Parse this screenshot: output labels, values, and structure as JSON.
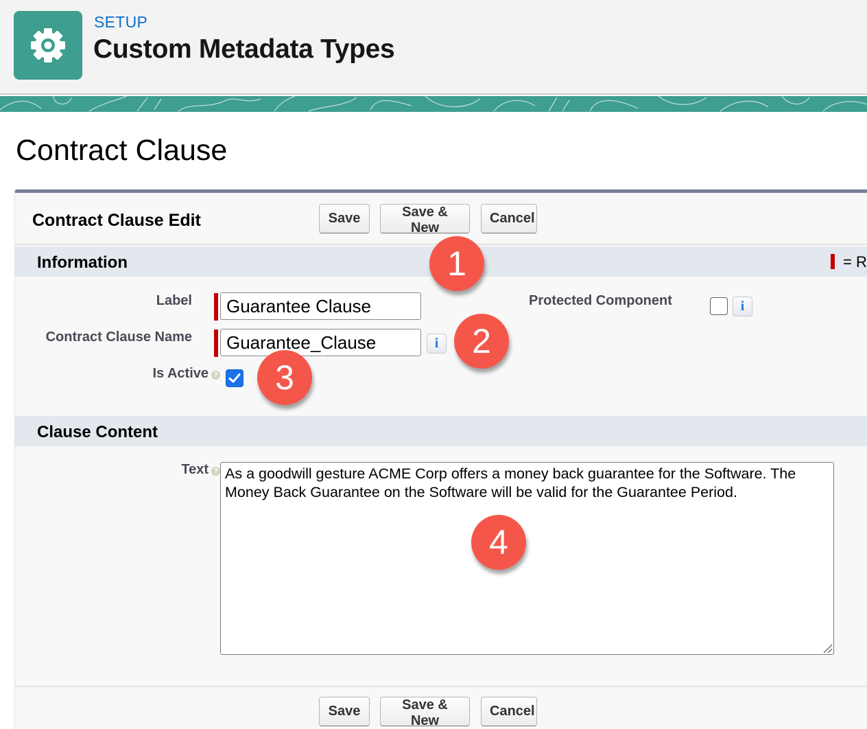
{
  "header": {
    "eyebrow": "SETUP",
    "title": "Custom Metadata Types",
    "icon": "gear-icon",
    "accent_color": "#3e9e8f"
  },
  "page": {
    "title": "Contract Clause"
  },
  "edit_block": {
    "title": "Contract Clause Edit",
    "buttons": {
      "save": "Save",
      "save_new": "Save & New",
      "cancel": "Cancel"
    },
    "required_legend": "= R",
    "required_color": "#c00000"
  },
  "sections": {
    "information": {
      "title": "Information",
      "fields": {
        "label": {
          "label": "Label",
          "value": "Guarantee Clause",
          "required": true
        },
        "name": {
          "label": "Contract Clause Name",
          "value": "Guarantee_Clause",
          "required": true,
          "info_icon": "i"
        },
        "is_active": {
          "label": "Is Active",
          "help_icon": "?",
          "checked": true
        },
        "protected": {
          "label": "Protected Component",
          "checked": false,
          "info_icon": "i"
        }
      }
    },
    "clause_content": {
      "title": "Clause Content",
      "fields": {
        "text": {
          "label": "Text",
          "help_icon": "?",
          "value": "As a goodwill gesture ACME Corp offers a money back guarantee for the Software. The Money Back Guarantee on the Software will be valid for the Guarantee Period."
        }
      }
    }
  },
  "callouts": [
    "1",
    "2",
    "3",
    "4"
  ],
  "callout_color": "#f4574a"
}
